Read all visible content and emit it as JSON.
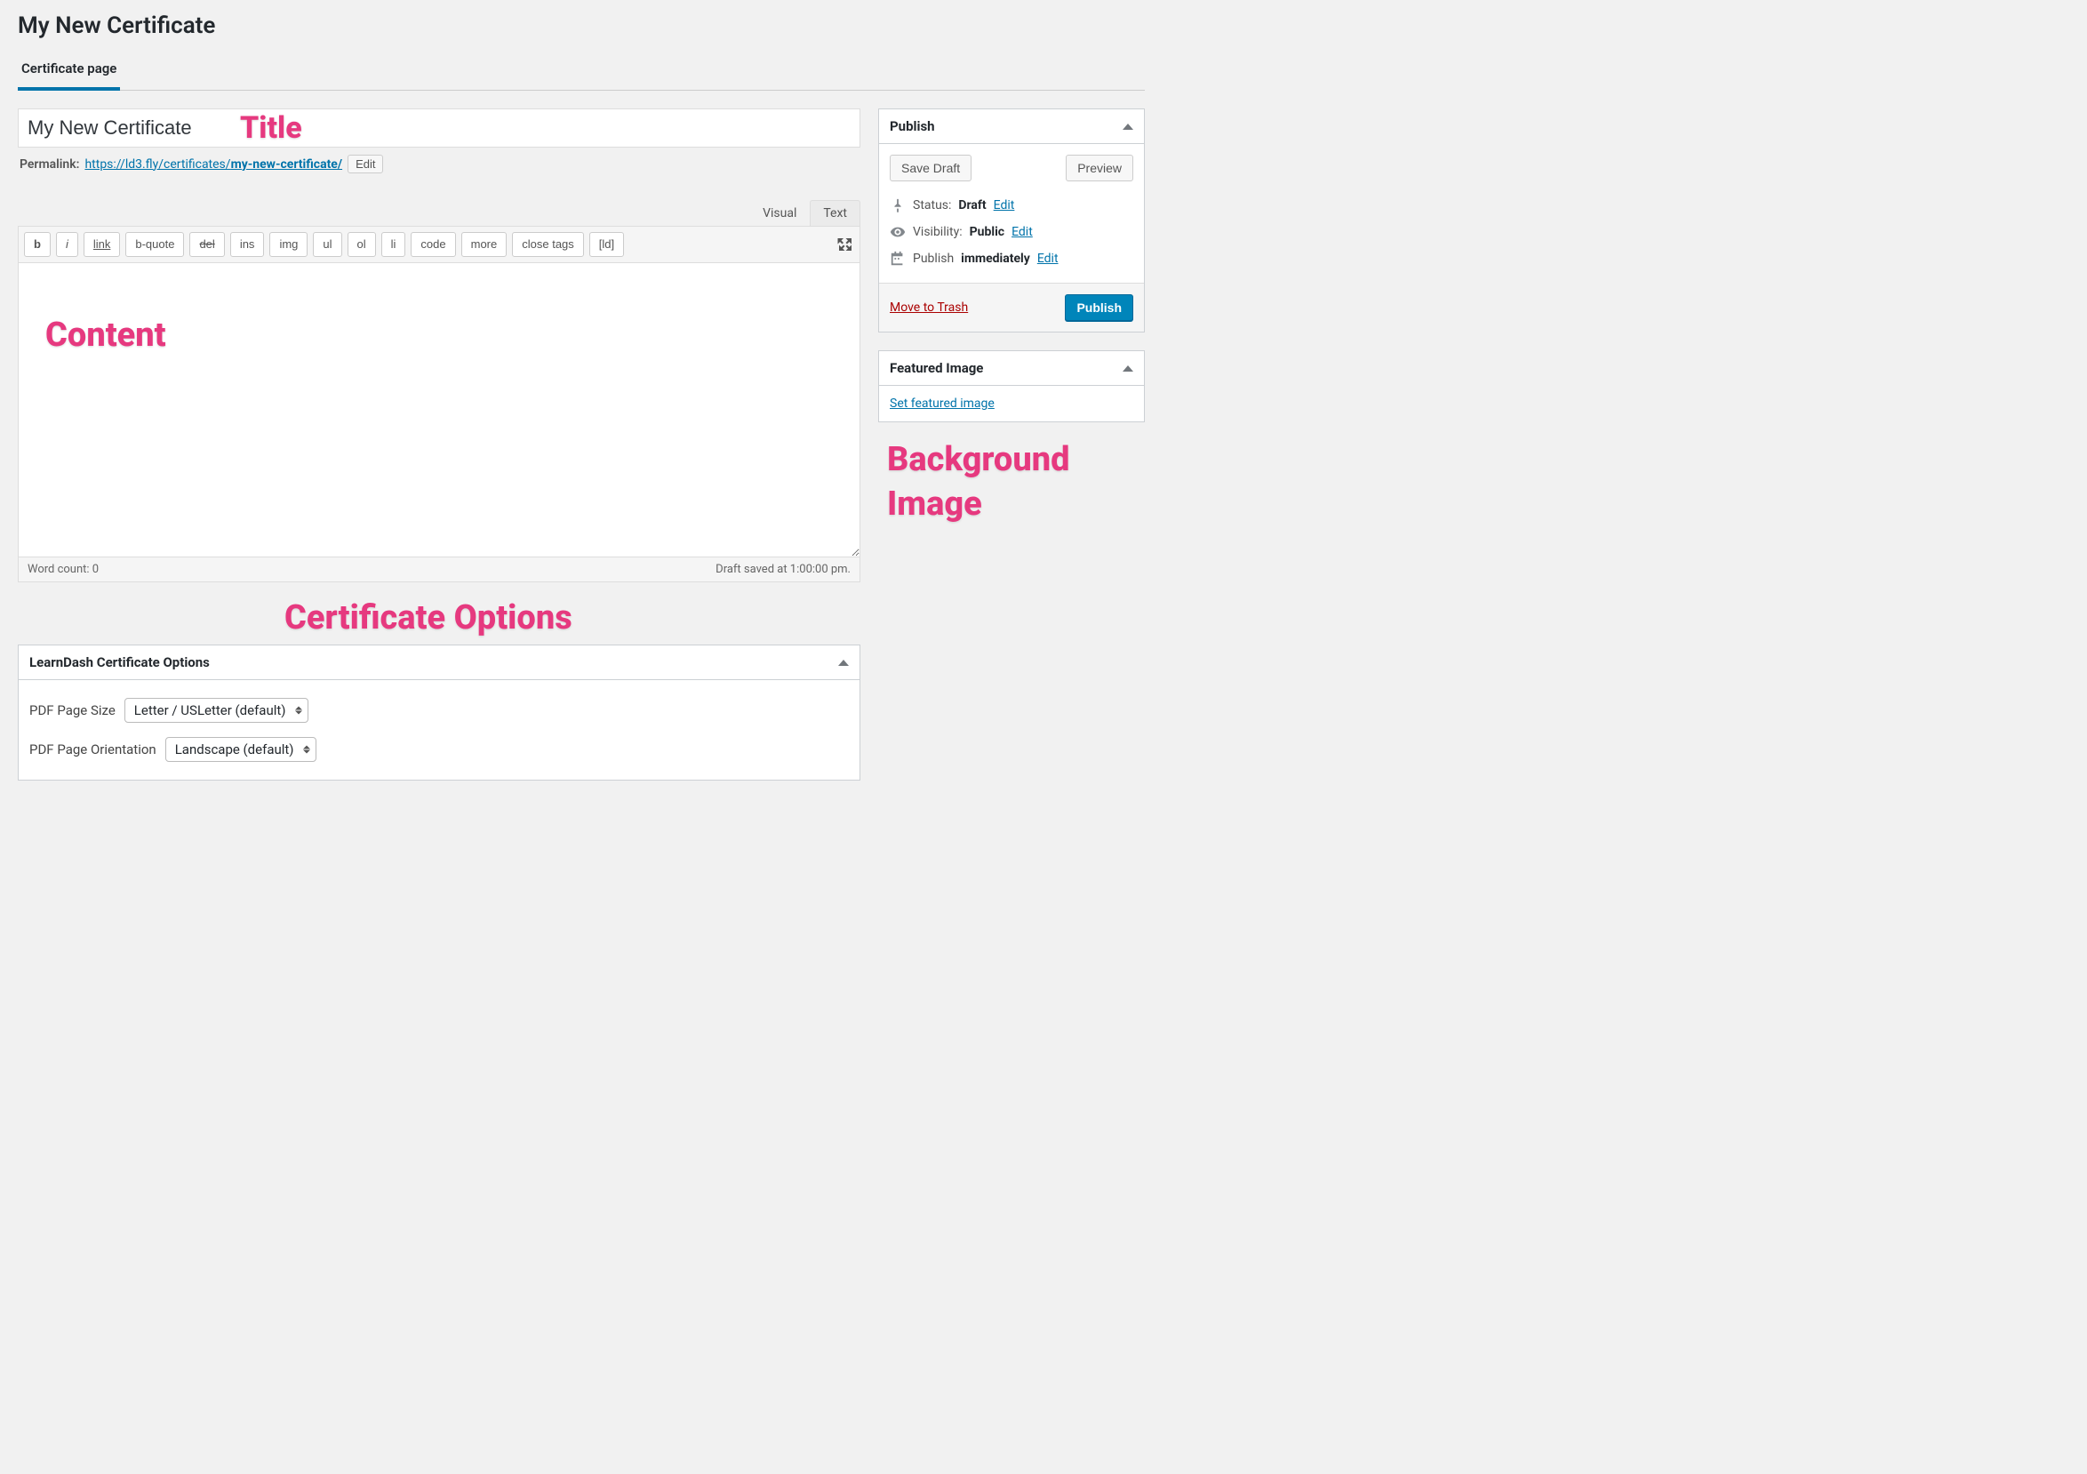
{
  "page": {
    "title": "My New Certificate"
  },
  "tabs": {
    "certificate_page": "Certificate page"
  },
  "title_field": {
    "value": "My New Certificate"
  },
  "permalink": {
    "label": "Permalink:",
    "base": "https://ld3.fly/certificates/",
    "slug": "my-new-certificate/",
    "edit": "Edit"
  },
  "editor": {
    "tab_visual": "Visual",
    "tab_text": "Text",
    "buttons": {
      "b": "b",
      "i": "i",
      "link": "link",
      "bquote": "b-quote",
      "del": "del",
      "ins": "ins",
      "img": "img",
      "ul": "ul",
      "ol": "ol",
      "li": "li",
      "code": "code",
      "more": "more",
      "close": "close tags",
      "ld": "[ld]"
    },
    "footer": {
      "wordcount_label": "Word count: ",
      "wordcount": "0",
      "saved": "Draft saved at 1:00:00 pm."
    }
  },
  "publish": {
    "title": "Publish",
    "save_draft": "Save Draft",
    "preview": "Preview",
    "status_label": "Status: ",
    "status_value": "Draft",
    "visibility_label": "Visibility: ",
    "visibility_value": "Public",
    "publish_label": "Publish ",
    "publish_value": "immediately",
    "edit": "Edit",
    "trash": "Move to Trash",
    "publish_btn": "Publish"
  },
  "featured": {
    "title": "Featured Image",
    "set_link": "Set featured image"
  },
  "cert_options": {
    "title": "LearnDash Certificate Options",
    "page_size_label": "PDF Page Size",
    "page_size_value": "Letter / USLetter (default)",
    "orientation_label": "PDF Page Orientation",
    "orientation_value": "Landscape (default)"
  },
  "callouts": {
    "title": "Title",
    "content": "Content",
    "cert": "Certificate Options",
    "bg1": "Background",
    "bg2": "Image"
  }
}
